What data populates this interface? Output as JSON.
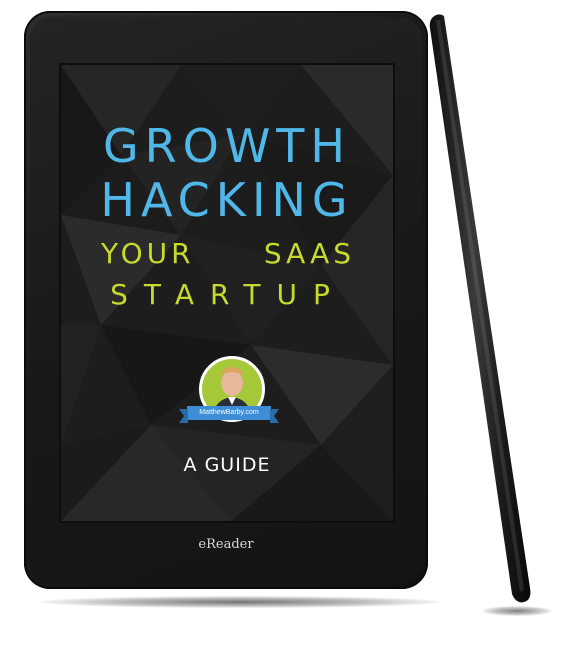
{
  "cover": {
    "title_line1": "GROWTH",
    "title_line2": "HACKING",
    "subtitle_word1": "YOUR",
    "subtitle_word2": "SAAS",
    "subtitle_line2": "STARTUP",
    "author_badge": "MatthewBarby.com",
    "guide_label": "A GUIDE"
  },
  "device": {
    "brand": "eReader"
  },
  "colors": {
    "title_blue": "#4fb8e8",
    "subtitle_green": "#c8d92e",
    "avatar_green": "#a6c93a",
    "ribbon_blue": "#3d8ed6"
  }
}
